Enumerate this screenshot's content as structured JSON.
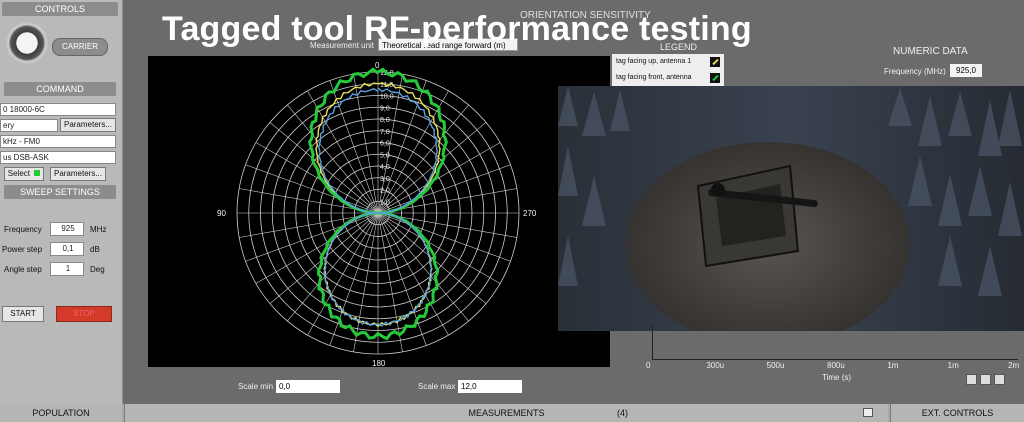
{
  "overlay_title": "Tagged tool RF-performance testing",
  "controls": {
    "header": "CONTROLS",
    "carrier_label": "CARRIER",
    "command_header": "COMMAND",
    "field1": "0 18000-6C",
    "field2": "ery",
    "parameters_label": "Parameters...",
    "field3": "kHz - FM0",
    "field4": "us DSB-ASK",
    "select_label": "Select",
    "parameters2_label": "Parameters...",
    "sweep_header": "SWEEP SETTINGS",
    "frequency_label": "Frequency",
    "frequency_value": "925",
    "frequency_unit": "MHz",
    "power_step_label": "Power step",
    "power_step_value": "0,1",
    "power_step_unit": "dB",
    "angle_step_label": "Angle step",
    "angle_step_value": "1",
    "angle_step_unit": "Deg",
    "start_label": "START",
    "stop_label": "STOP"
  },
  "orientation": {
    "title": "ORIENTATION SENSITIVITY",
    "measurement_unit_label": "Measurement unit",
    "measurement_unit_value": "Theoretical read range forward (m)",
    "legend_title": "LEGEND",
    "legend_items": [
      "tag facing up, antenna 1",
      "tag facing front, antenna"
    ],
    "scale_min_label": "Scale min",
    "scale_min_value": "0,0",
    "scale_max_label": "Scale max",
    "scale_max_value": "12,0"
  },
  "numeric": {
    "title": "NUMERIC DATA",
    "frequency_label": "Frequency (MHz)",
    "frequency_value": "925,0"
  },
  "time_axis": {
    "ticks": [
      "0",
      "300u",
      "500u",
      "800u",
      "1m",
      "1m",
      "2m"
    ],
    "label": "Time (s)"
  },
  "bottom": {
    "population": "POPULATION",
    "measurements": "MEASUREMENTS",
    "count": "(4)",
    "ext_controls": "EXT. CONTROLS"
  },
  "chart_data": {
    "type": "polar",
    "angle_labels": [
      "0",
      "90",
      "180",
      "270"
    ],
    "radial_ticks": [
      "0",
      "1,0",
      "2,0",
      "3,0",
      "4,0",
      "5,0",
      "6,0",
      "7,0",
      "8,0",
      "9,0",
      "10,0",
      "11,0",
      "12,0"
    ],
    "rlim": [
      0,
      12
    ],
    "series": [
      {
        "name": "tag facing up, antenna 1",
        "color": "#e8e05a",
        "shape": "figure-eight",
        "r_max_top": 11.0,
        "r_max_bottom": 9.5
      },
      {
        "name": "tag facing front, antenna",
        "color": "#25c93a",
        "shape": "figure-eight",
        "r_max_top": 12.0,
        "r_max_bottom": 10.5
      },
      {
        "color": "#5aa0e0",
        "shape": "figure-eight",
        "r_max_top": 10.5,
        "r_max_bottom": 9.5
      }
    ]
  },
  "colors": {
    "accent_green": "#25c93a",
    "accent_yellow": "#e8e05a",
    "stop_red": "#d43a2a"
  }
}
